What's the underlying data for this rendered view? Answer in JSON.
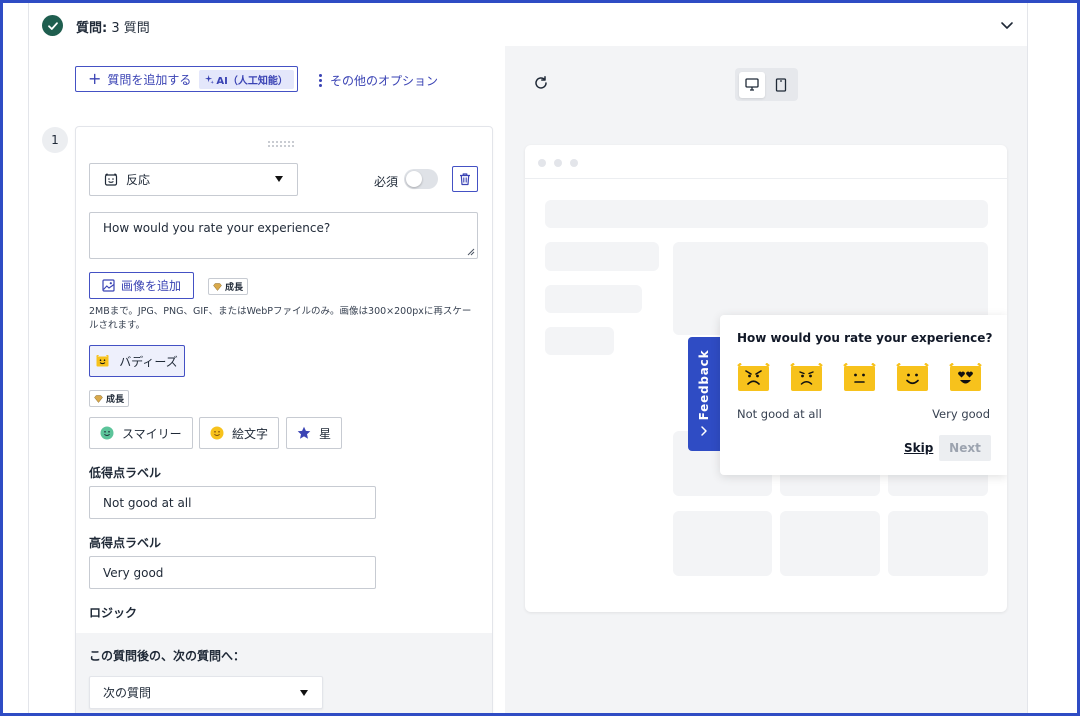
{
  "section": {
    "title_prefix": "質問:",
    "title_count": " 3 質問"
  },
  "toolbar": {
    "add_question_label": "質問を追加する",
    "ai_badge_label": "AI（人工知能）",
    "more_options_label": "その他のオプション"
  },
  "question": {
    "number": "1",
    "type_label": "反応",
    "required_label": "必須",
    "required_on": false,
    "text": "How would you rate your experience?",
    "add_image_label": "画像を追加",
    "growth_badge_label": "成長",
    "image_help": "2MBまで。JPG、PNG、GIF、またはWebPファイルのみ。画像は300×200pxに再スケールされます。",
    "style_selected_label": "バディーズ",
    "style_options": [
      "スマイリー",
      "絵文字",
      "星"
    ],
    "low_label_heading": "低得点ラベル",
    "low_label_value": "Not good at all",
    "high_label_heading": "高得点ラベル",
    "high_label_value": "Very good",
    "logic_heading": "ロジック",
    "after_question_label": "この質問後の、次の質問へ：",
    "next_question_value": "次の質問"
  },
  "preview": {
    "device_selected": "desktop",
    "feedback_tab_label": "Feedback",
    "question": "How would you rate your experience?",
    "emoji_scale": [
      "angry-buddy",
      "sad-buddy",
      "neutral-buddy",
      "happy-buddy",
      "love-buddy"
    ],
    "low_label": "Not good at all",
    "high_label": "Very good",
    "skip_label": "Skip",
    "next_label": "Next"
  },
  "colors": {
    "accent": "#3a43b4",
    "check_green": "#1f5e4f",
    "feedback_blue": "#2f4cc4",
    "buddy_yellow": "#f7c21c"
  }
}
